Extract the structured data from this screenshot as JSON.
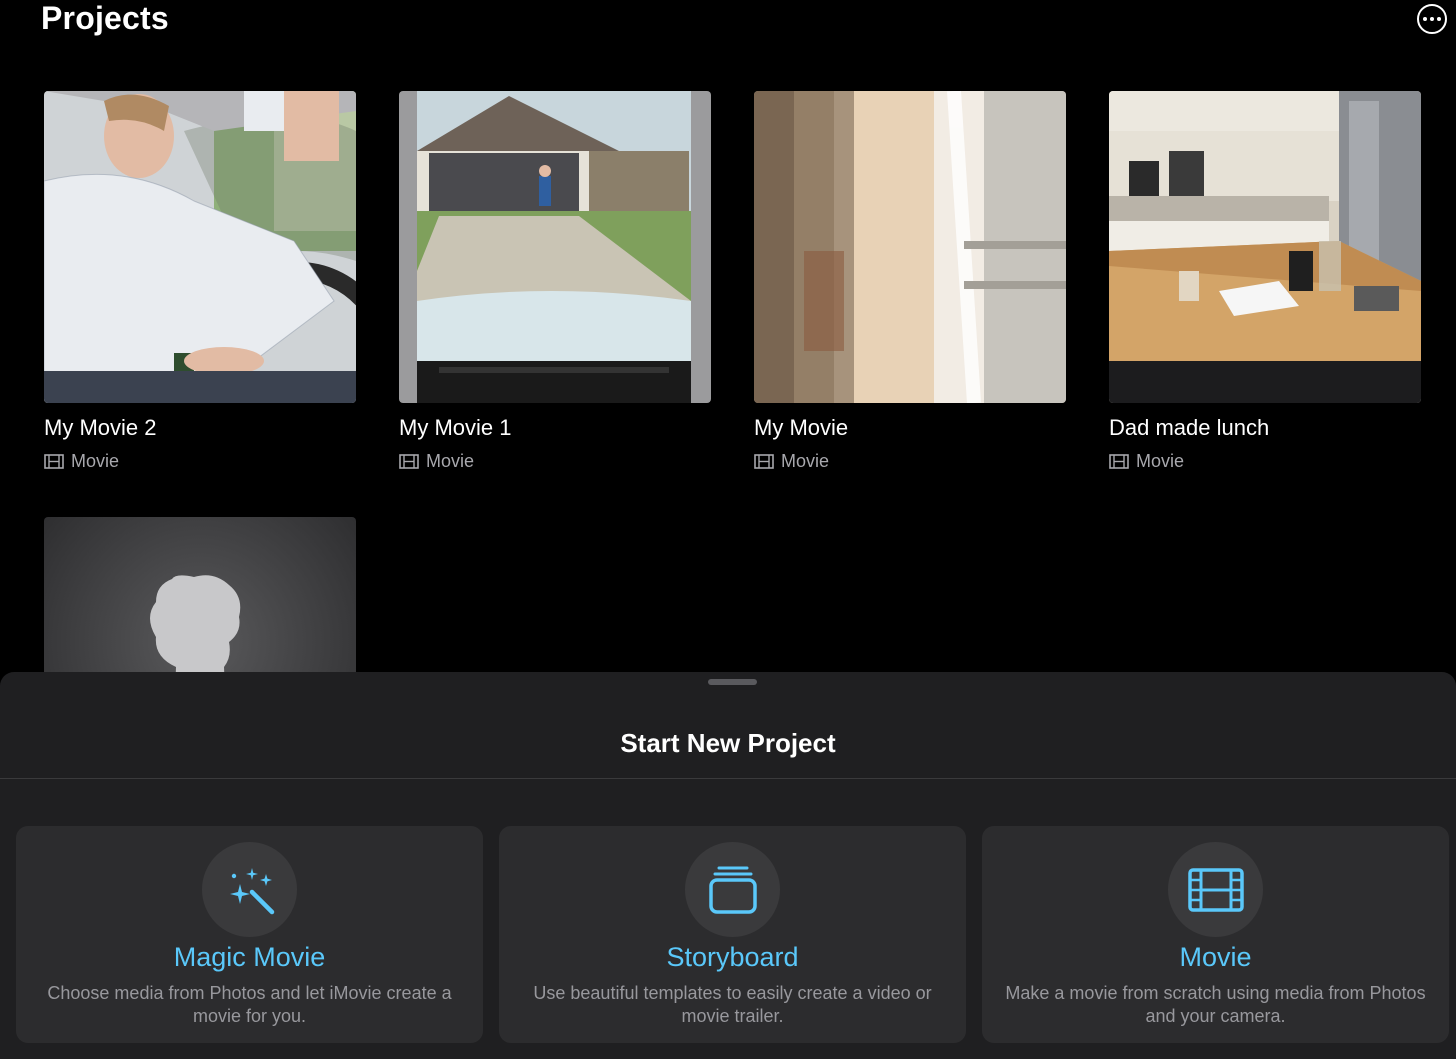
{
  "header": {
    "title": "Projects",
    "more_icon": "ellipsis-circle-icon"
  },
  "projects": [
    {
      "name": "My Movie 2",
      "type": "Movie",
      "thumbnail": "man-driving-car"
    },
    {
      "name": "My Movie 1",
      "type": "Movie",
      "thumbnail": "child-in-driveway"
    },
    {
      "name": "My Movie",
      "type": "Movie",
      "thumbnail": "blurry-door"
    },
    {
      "name": "Dad made lunch",
      "type": "Movie",
      "thumbnail": "kitchen-counter"
    },
    {
      "name": "",
      "type": "",
      "thumbnail": "placeholder-silhouette"
    }
  ],
  "sheet": {
    "title": "Start New Project",
    "options": [
      {
        "title": "Magic Movie",
        "description": "Choose media from Photos and let iMovie create a movie for you.",
        "icon": "magic-wand-icon"
      },
      {
        "title": "Storyboard",
        "description": "Use beautiful templates to easily create a video or movie trailer.",
        "icon": "storyboard-stack-icon"
      },
      {
        "title": "Movie",
        "description": "Make a movie from scratch using media from Photos and your camera.",
        "icon": "film-strip-icon"
      }
    ]
  },
  "colors": {
    "accent": "#5ac8fa",
    "background": "#000000",
    "sheet": "#1f1f21",
    "card": "#2c2c2e",
    "secondary_text": "#98989d"
  }
}
